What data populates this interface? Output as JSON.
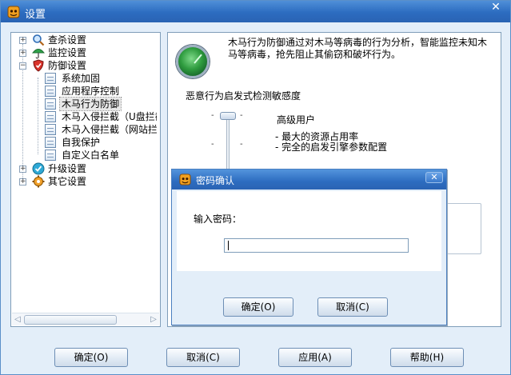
{
  "window": {
    "title": "设置",
    "close_label": "✕"
  },
  "tree": {
    "items": [
      {
        "label": "查杀设置",
        "icon": "magnifier-icon"
      },
      {
        "label": "监控设置",
        "icon": "umbrella-icon"
      },
      {
        "label": "防御设置",
        "icon": "shield-icon"
      },
      {
        "label": "系统加固",
        "icon": "document-icon"
      },
      {
        "label": "应用程序控制",
        "icon": "document-icon"
      },
      {
        "label": "木马行为防御",
        "icon": "document-icon"
      },
      {
        "label": "木马入侵拦截（U盘拦截",
        "icon": "document-icon"
      },
      {
        "label": "木马入侵拦截（网站拦截",
        "icon": "document-icon"
      },
      {
        "label": "自我保护",
        "icon": "document-icon"
      },
      {
        "label": "自定义白名单",
        "icon": "document-icon"
      },
      {
        "label": "升级设置",
        "icon": "check-icon"
      },
      {
        "label": "其它设置",
        "icon": "gear-icon"
      }
    ],
    "expander_plus": "+",
    "expander_minus": "−",
    "scroll_left": "◁",
    "scroll_right": "▷"
  },
  "panel": {
    "description": "木马行为防御通过对木马等病毒的行为分析，智能监控未知木马等病毒，抢先阻止其偷窃和破坏行为。",
    "sensitivity_title": "恶意行为启发式检测敏感度",
    "level_name": "高级用户",
    "level_details": [
      "- 最大的资源占用率",
      "- 完全的启发引擎参数配置"
    ],
    "tick": "-"
  },
  "buttons": {
    "ok": "确定(O)",
    "cancel": "取消(C)",
    "apply": "应用(A)",
    "help": "帮助(H)"
  },
  "dialog": {
    "title": "密码确认",
    "close_label": "✕",
    "password_label": "输入密码：",
    "password_value": "",
    "ok": "确定(O)",
    "cancel": "取消(C)"
  }
}
